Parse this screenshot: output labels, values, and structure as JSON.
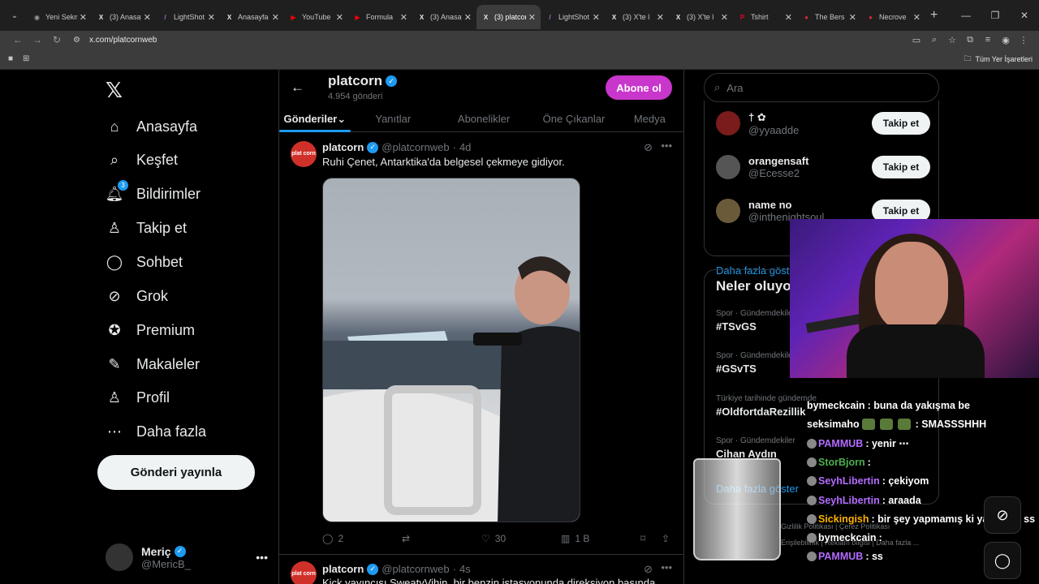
{
  "browser": {
    "tabs": [
      {
        "title": "Yeni Sekme",
        "fav": "chrome-icon",
        "favColor": "#9aa0a6"
      },
      {
        "title": "(3) Anasayfa",
        "fav": "x-icon",
        "favColor": "#e8eaed"
      },
      {
        "title": "LightShot",
        "fav": "lightshot-icon",
        "favColor": "#b06ad9"
      },
      {
        "title": "Anasayfa",
        "fav": "x-icon",
        "favColor": "#e8eaed"
      },
      {
        "title": "YouTube",
        "fav": "youtube-icon",
        "favColor": "#ff0000"
      },
      {
        "title": "Formula",
        "fav": "youtube-icon",
        "favColor": "#ff0000"
      },
      {
        "title": "(3) Anasayfa",
        "fav": "x-icon",
        "favColor": "#e8eaed"
      },
      {
        "title": "(3) platcorn",
        "fav": "x-icon",
        "favColor": "#e8eaed",
        "active": true
      },
      {
        "title": "LightShot",
        "fav": "lightshot-icon",
        "favColor": "#b06ad9"
      },
      {
        "title": "(3) X'te l",
        "fav": "x-icon",
        "favColor": "#e8eaed"
      },
      {
        "title": "(3) X'te l",
        "fav": "x-icon",
        "favColor": "#e8eaed"
      },
      {
        "title": "Tshirt",
        "fav": "pinterest-icon",
        "favColor": "#e60023"
      },
      {
        "title": "The Bers",
        "fav": "red-icon",
        "favColor": "#e0242c"
      },
      {
        "title": "Necrove",
        "fav": "red-icon",
        "favColor": "#e0242c"
      }
    ],
    "url": "x.com/platcornweb",
    "bookmarks_all": "Tüm Yer İşaretleri"
  },
  "nav": {
    "items": [
      {
        "label": "Anasayfa",
        "icon": "home-icon"
      },
      {
        "label": "Keşfet",
        "icon": "search-icon"
      },
      {
        "label": "Bildirimler",
        "icon": "bell-icon",
        "badge": "3"
      },
      {
        "label": "Takip et",
        "icon": "follow-icon"
      },
      {
        "label": "Sohbet",
        "icon": "chat-icon"
      },
      {
        "label": "Grok",
        "icon": "grok-icon"
      },
      {
        "label": "Premium",
        "icon": "premium-icon"
      },
      {
        "label": "Makaleler",
        "icon": "articles-icon"
      },
      {
        "label": "Profil",
        "icon": "profile-icon"
      },
      {
        "label": "Daha fazla",
        "icon": "more-icon"
      }
    ],
    "post_button": "Gönderi yayınla",
    "account": {
      "name": "Meriç",
      "handle": "@MericB_"
    }
  },
  "profile": {
    "name": "platcorn",
    "post_count": "4.954 gönderi",
    "subscribe": "Abone ol",
    "tabs": [
      "Gönderiler",
      "Yanıtlar",
      "Abonelikler",
      "Öne Çıkanlar",
      "Medya"
    ]
  },
  "tweet": {
    "avatar_text": "plat corn",
    "name": "platcorn",
    "handle": "@platcornweb",
    "time": "4d",
    "text": "Ruhi Çenet, Antarktika'da belgesel çekmeye gidiyor.",
    "replies": "2",
    "likes": "30",
    "views": "1 B"
  },
  "tweet2": {
    "name": "platcorn",
    "handle": "@platcornweb",
    "time": "4s",
    "text": "Kick yayıncısı SweatyVihin, bir benzin istasyonunda direksiyon başında"
  },
  "sidebar": {
    "search_placeholder": "Ara",
    "who_to_follow": [
      {
        "name": "† ✿",
        "handle": "@yyaadde",
        "btn": "Takip et"
      },
      {
        "name": "orangensaft",
        "handle": "@Ecesse2",
        "btn": "Takip et"
      },
      {
        "name": "name no",
        "handle": "@inthenightsoul_",
        "btn": "Takip et"
      }
    ],
    "show_more": "Daha fazla göster",
    "trends_title": "Neler oluyor",
    "trends": [
      {
        "cat": "Spor · Gündemdekiler",
        "name": "#TSvGS"
      },
      {
        "cat": "Spor · Gündemdekiler",
        "name": "#GSvTS"
      },
      {
        "cat": "Türkiye tarihinde gündemde",
        "name": "#OldfortdaRezillik"
      },
      {
        "cat": "Spor · Gündemdekiler",
        "name": "Cihan Aydın"
      }
    ],
    "show_more2": "Daha fazla göster",
    "footer": [
      "Gizlilik Politikası",
      "Çerez Politikası",
      "Erişilebilirlik",
      "Reklam bilgisi",
      "Daha fazla ..."
    ]
  },
  "chat": [
    {
      "user": "bymeckcain",
      "color": "#ffffff",
      "msg": ": buna da yakışma be"
    },
    {
      "user": "seksimaho",
      "color": "#ffffff",
      "msg": ": SMASSSHHH",
      "emotes": 3
    },
    {
      "user": "PAMMUB",
      "color": "#b36bff",
      "msg": ": yenir ⋯"
    },
    {
      "user": "StorBjorn",
      "color": "#4caf50",
      "msg": ":"
    },
    {
      "user": "SeyhLibertin",
      "color": "#b36bff",
      "msg": ": çekiyom"
    },
    {
      "user": "SeyhLibertin",
      "color": "#b36bff",
      "msg": ": araada"
    },
    {
      "user": "Sickingish",
      "color": "#ffb300",
      "msg": ": bir şey yapmamış ki yayından ss"
    },
    {
      "user": "bymeckcain",
      "color": "#ffffff",
      "msg": ":"
    },
    {
      "user": "PAMMUB",
      "color": "#b36bff",
      "msg": ": ss"
    }
  ]
}
